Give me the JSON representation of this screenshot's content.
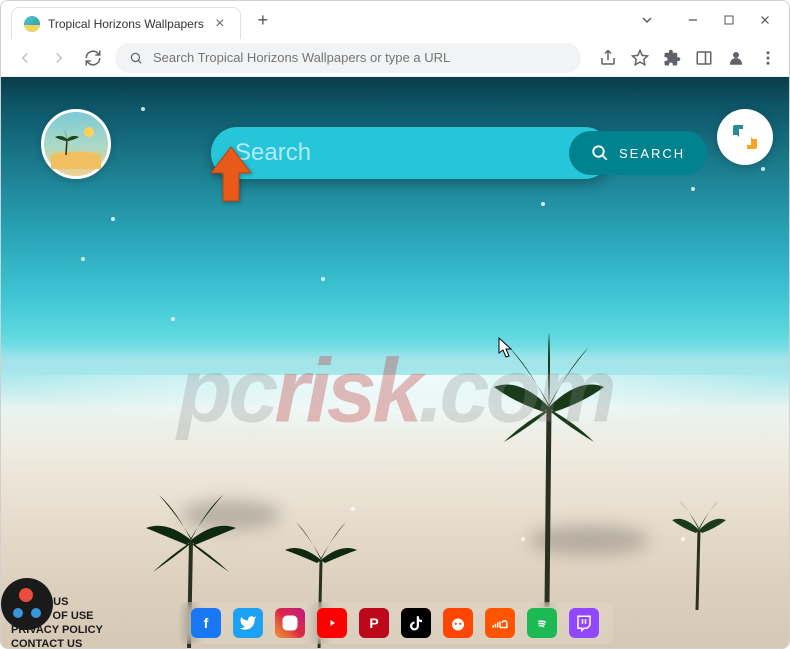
{
  "tab": {
    "title": "Tropical Horizons Wallpapers"
  },
  "omnibox": {
    "placeholder": "Search Tropical Horizons Wallpapers or type a URL"
  },
  "search": {
    "placeholder": "Search",
    "button_label": "SEARCH"
  },
  "footer": {
    "about": "ABOUT US",
    "terms": "TERMS OF USE",
    "privacy": "PRIVACY POLICY",
    "contact": "CONTACT US"
  },
  "dock": [
    {
      "name": "facebook",
      "bg": "#1877f2",
      "glyph": "f"
    },
    {
      "name": "twitter",
      "bg": "#1da1f2",
      "glyph": "t"
    },
    {
      "name": "instagram",
      "bg": "linear-gradient(45deg,#f09433,#e6683c,#dc2743,#cc2366,#bc1888)",
      "glyph": "ig"
    },
    {
      "name": "youtube",
      "bg": "#ff0000",
      "glyph": "yt"
    },
    {
      "name": "pinterest",
      "bg": "#bd081c",
      "glyph": "p"
    },
    {
      "name": "tiktok",
      "bg": "#000000",
      "glyph": "tk"
    },
    {
      "name": "reddit",
      "bg": "#ff4500",
      "glyph": "r"
    },
    {
      "name": "soundcloud",
      "bg": "#ff5500",
      "glyph": "sc"
    },
    {
      "name": "spotify",
      "bg": "#1db954",
      "glyph": "sp"
    },
    {
      "name": "twitch",
      "bg": "#9146ff",
      "glyph": "tw"
    }
  ],
  "watermark": {
    "text_gray": "pc",
    "text_red": "risk",
    "text_gray2": ".com"
  },
  "colors": {
    "accent": "#26c6da",
    "accent_dark": "#00838f"
  }
}
